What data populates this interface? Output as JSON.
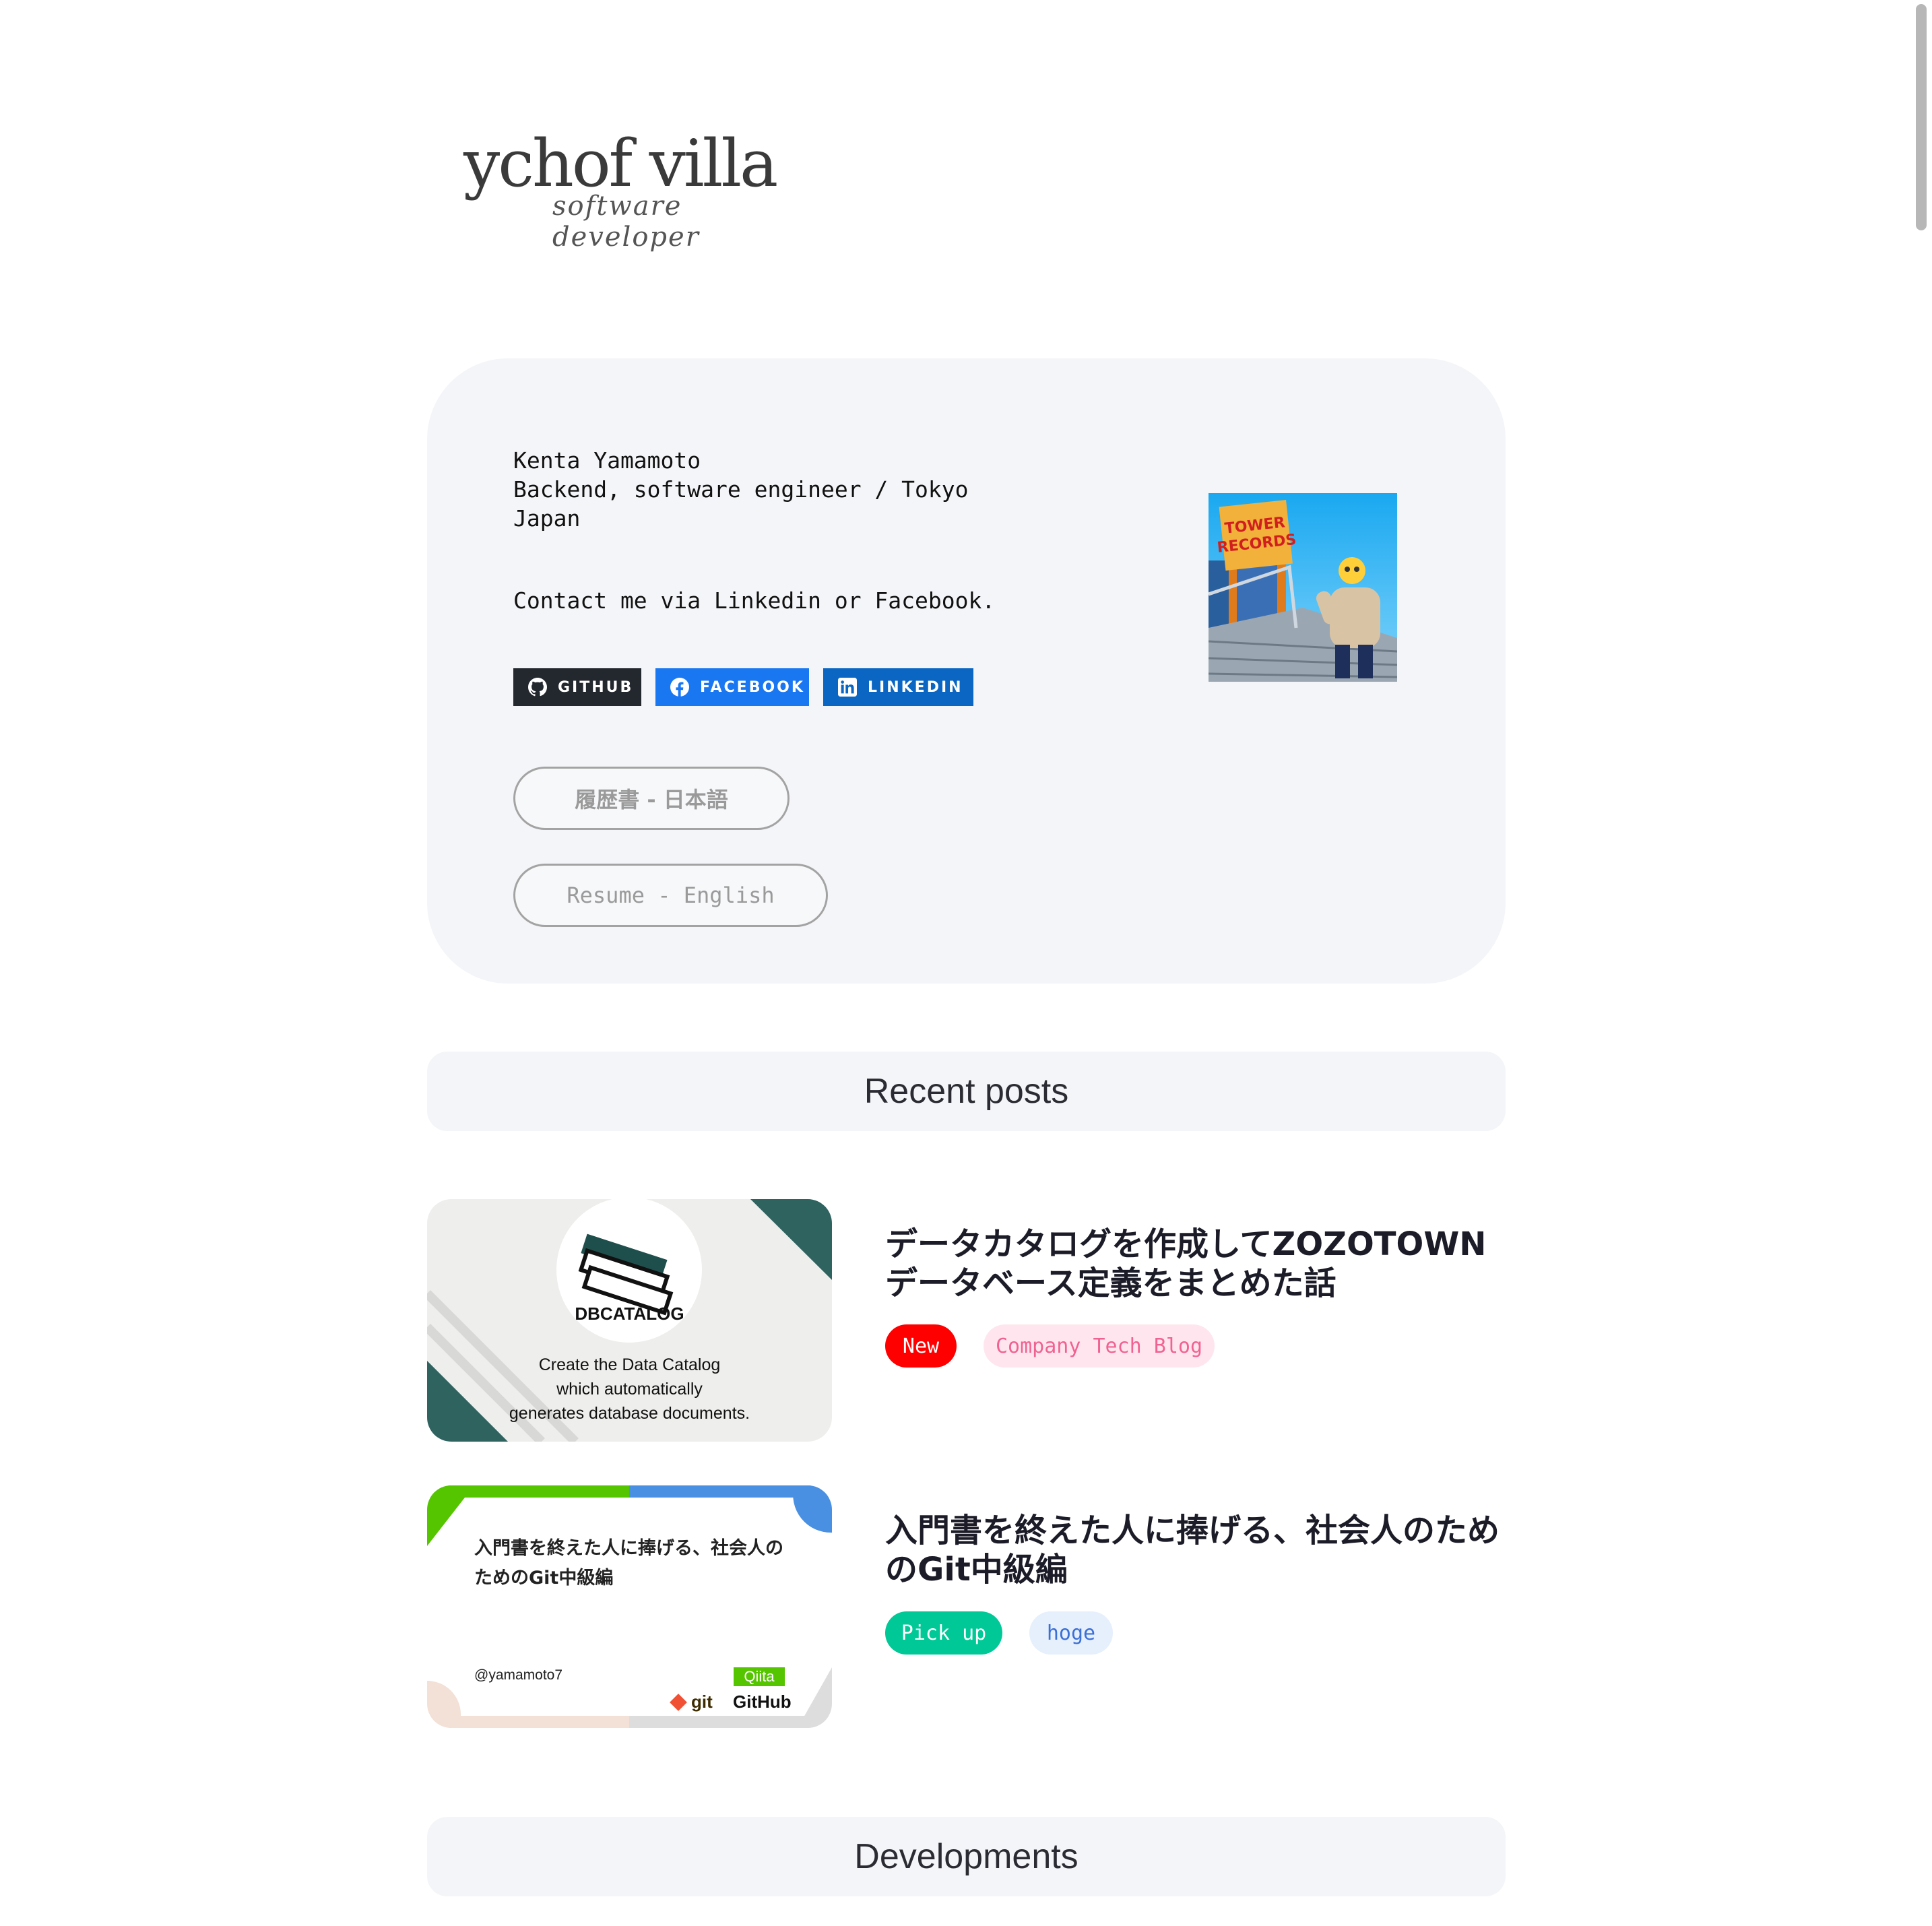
{
  "logo": {
    "name": "ychof villa",
    "tagline": "software developer"
  },
  "profile": {
    "lines": [
      "Kenta Yamamoto",
      "Backend, software engineer / Tokyo",
      "Japan"
    ],
    "contact": "Contact me via Linkedin or Facebook.",
    "social": {
      "github": "GITHUB",
      "facebook": "FACEBOOK",
      "linkedin": "LINKEDIN"
    },
    "resume_ja": "履歴書 - 日本語",
    "resume_en": "Resume - English",
    "avatar_sign": {
      "line1": "TOWER",
      "line2": "RECORDS"
    }
  },
  "sections": {
    "recent_posts": "Recent posts",
    "developments": "Developments"
  },
  "posts": [
    {
      "title": "データカタログを作成してZOZOTOWNデータベース定義をまとめた話",
      "tags": [
        "New",
        "Company Tech Blog"
      ],
      "thumb": {
        "logo_text": "DBCATALOG",
        "lines": [
          "Create the Data Catalog",
          "which automatically",
          "generates database documents."
        ]
      }
    },
    {
      "title": "入門書を終えた人に捧げる、社会人のためのGit中級編",
      "tags": [
        "Pick up",
        "hoge"
      ],
      "thumb": {
        "title": "入門書を終えた人に捧げる、社会人のためのGit中級編",
        "author": "@yamamoto7",
        "badge": "Qiita",
        "git": "git",
        "github": "GitHub"
      }
    }
  ],
  "colors": {
    "card_bg": "#f4f5f8",
    "github": "#23272e",
    "facebook": "#1a77f2",
    "linkedin": "#0a66c2",
    "tag_new": "#ff0000",
    "tag_company": "#ffe6ee",
    "tag_pickup": "#00c896",
    "tag_hoge": "#e6effc"
  }
}
